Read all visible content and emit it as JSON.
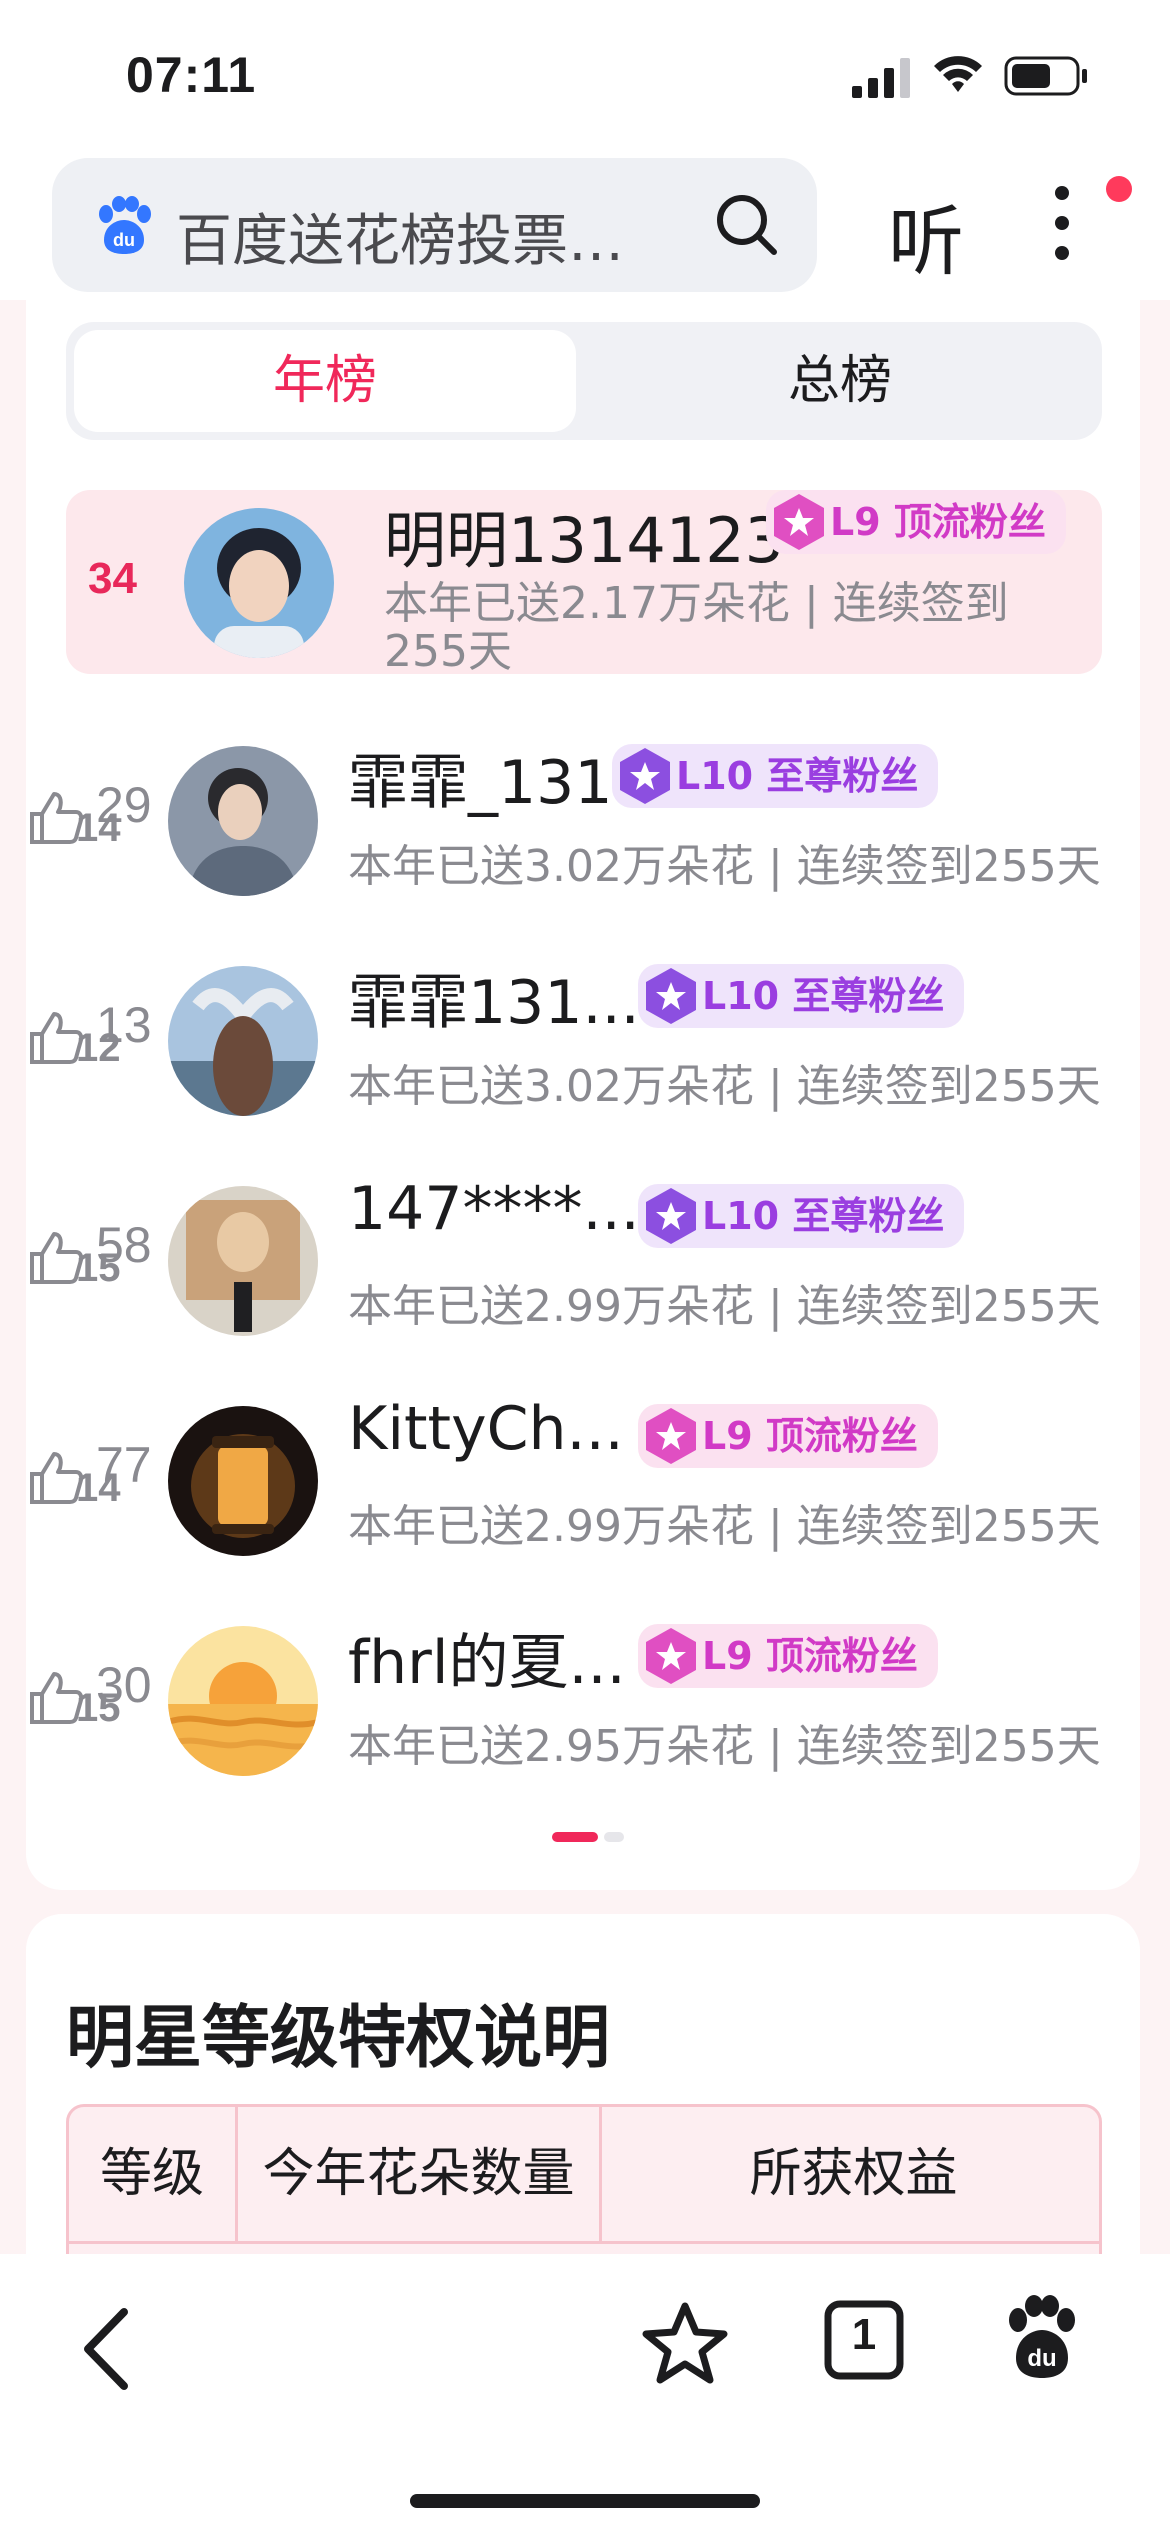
{
  "status_bar": {
    "time": "07:11"
  },
  "search": {
    "query": "百度送花榜投票…",
    "listen_label": "听"
  },
  "tabs": [
    {
      "label": "年榜",
      "active": true
    },
    {
      "label": "总榜",
      "active": false
    }
  ],
  "my_entry": {
    "rank": "34",
    "username": "明明1314123",
    "badge": "L9 顶流粉丝",
    "stat": "本年已送2.17万朵花 | 连续签到255天"
  },
  "entries": [
    {
      "likes": "29",
      "likes_overlay": "14",
      "username": "霏霏_131",
      "badge": "L10 至尊粉丝",
      "badge_type": "purple",
      "stat": "本年已送3.02万朵花 | 连续签到255天"
    },
    {
      "likes": "13",
      "likes_overlay": "12",
      "username": "霏霏131...",
      "badge": "L10 至尊粉丝",
      "badge_type": "purple",
      "stat": "本年已送3.02万朵花 | 连续签到255天"
    },
    {
      "likes": "58",
      "likes_overlay": "15",
      "username": "147****...",
      "badge": "L10 至尊粉丝",
      "badge_type": "purple",
      "stat": "本年已送2.99万朵花 | 连续签到255天"
    },
    {
      "likes": "77",
      "likes_overlay": "14",
      "username": "KittyCh...",
      "badge": "L9 顶流粉丝",
      "badge_type": "pink",
      "stat": "本年已送2.99万朵花 | 连续签到255天"
    },
    {
      "likes": "30",
      "likes_overlay": "15",
      "username": "fhrl的夏...",
      "badge": "L9 顶流粉丝",
      "badge_type": "pink",
      "stat": "本年已送2.95万朵花 | 连续签到255天"
    }
  ],
  "privilege_section": {
    "title": "明星等级特权说明",
    "columns": [
      "等级",
      "今年花朵数量",
      "所获权益"
    ]
  },
  "toolbar": {
    "tab_count": "1"
  },
  "colors": {
    "accent": "#f0285a",
    "purple_badge": "#9a3ee0",
    "pink_badge": "#d13ac6",
    "muted_text": "#8a8a90"
  },
  "icons": [
    "signal-icon",
    "wifi-icon",
    "battery-icon",
    "baidu-paw-icon",
    "search-icon",
    "more-icon",
    "thumb-up-icon",
    "back-icon",
    "star-icon",
    "tabs-icon",
    "baidu-home-icon"
  ]
}
